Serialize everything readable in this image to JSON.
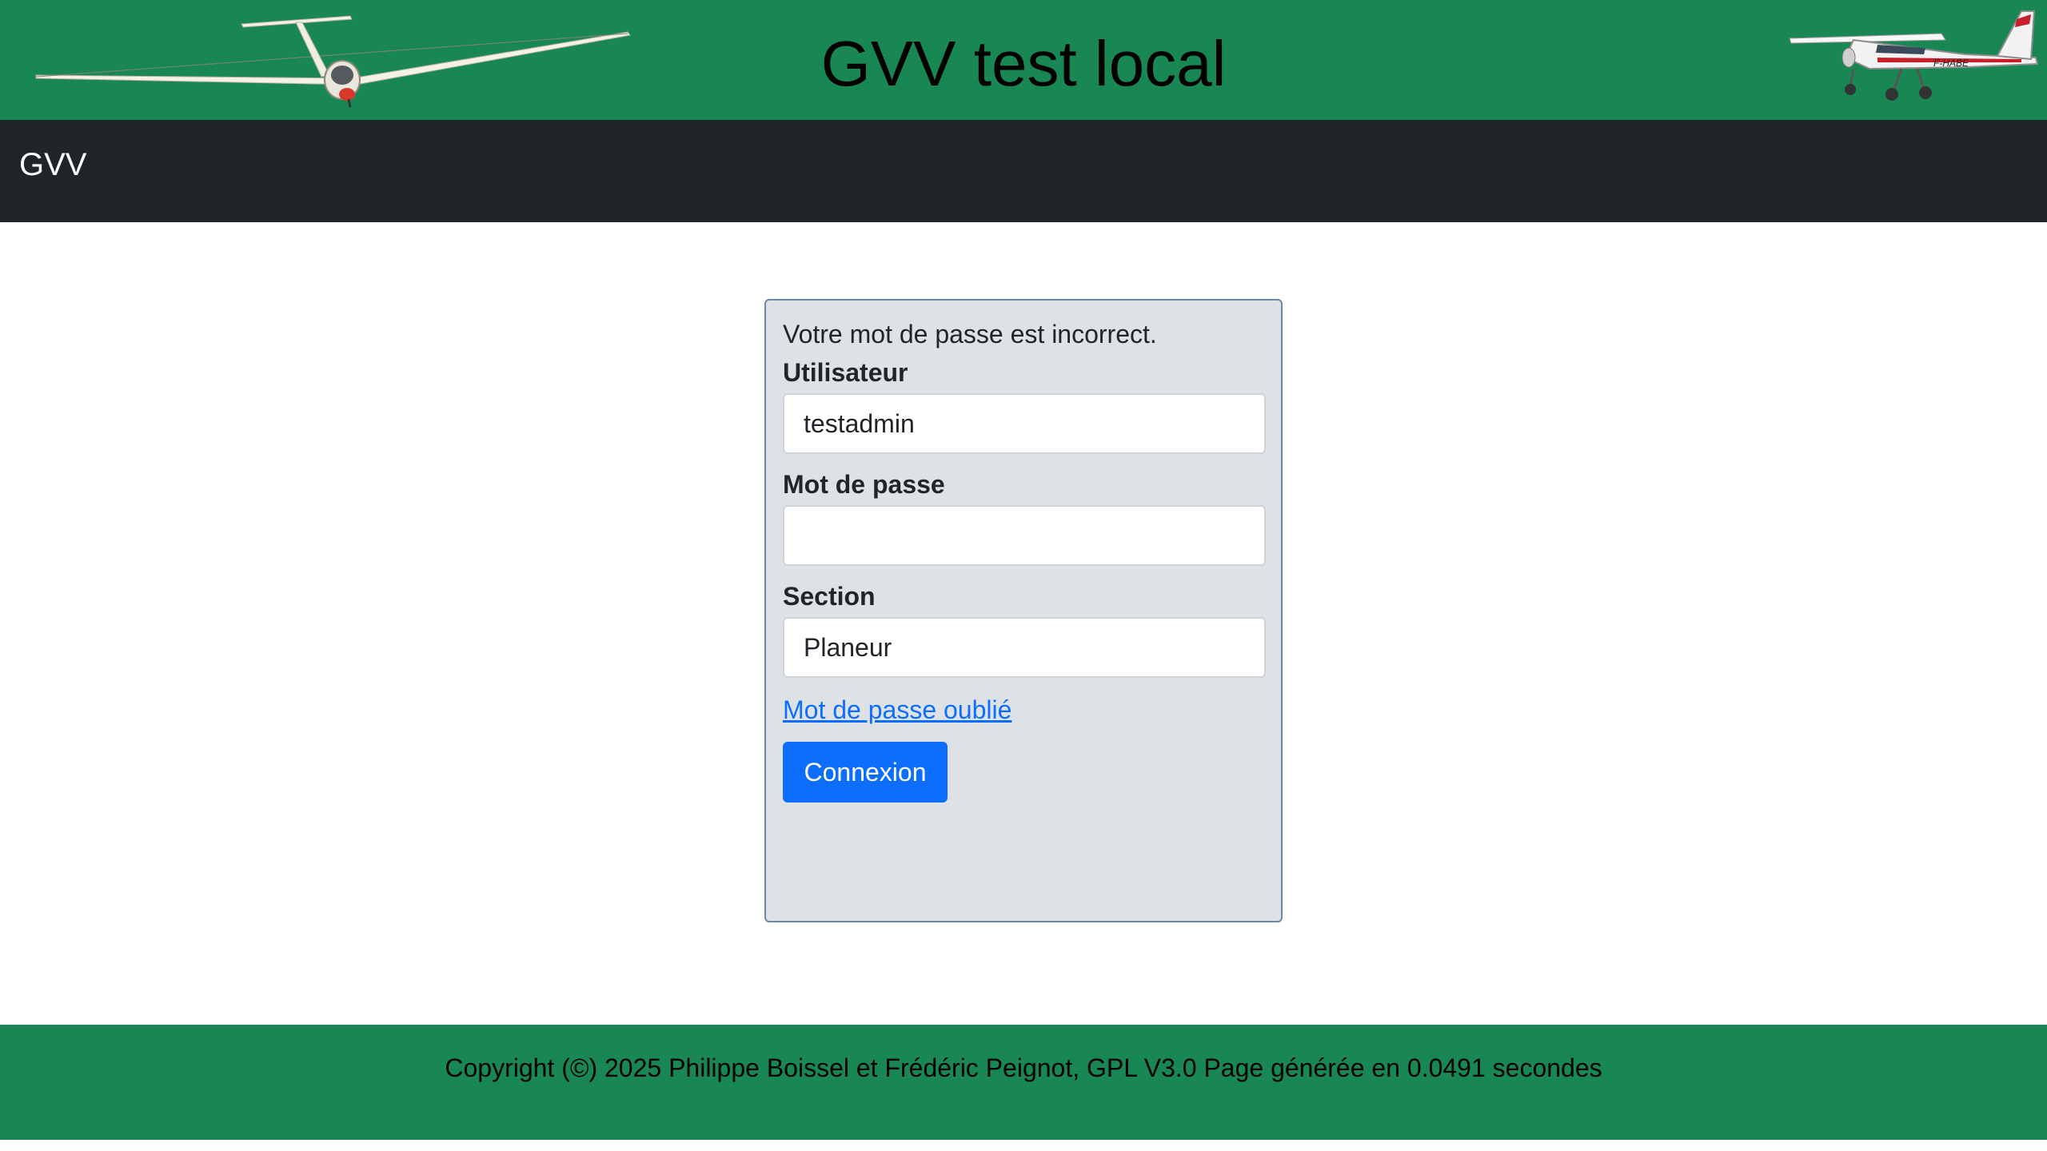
{
  "banner": {
    "title": "GVV test local",
    "background_color": "#198754",
    "left_image": "glider-image",
    "right_image": "cessna-plane-image"
  },
  "navbar": {
    "brand": "GVV",
    "background_color": "#212529"
  },
  "login": {
    "error_message": "Votre mot de passe est incorrect.",
    "username_label": "Utilisateur",
    "username_value": "testadmin",
    "password_label": "Mot de passe",
    "password_value": "",
    "section_label": "Section",
    "section_value": "Planeur",
    "forgot_password_link": "Mot de passe oublié",
    "submit_label": "Connexion",
    "submit_color": "#0d6efd"
  },
  "footer": {
    "text": "Copyright (©) 2025 Philippe Boissel et Frédéric Peignot, GPL V3.0 Page générée en 0.0491 secondes",
    "background_color": "#198754"
  }
}
